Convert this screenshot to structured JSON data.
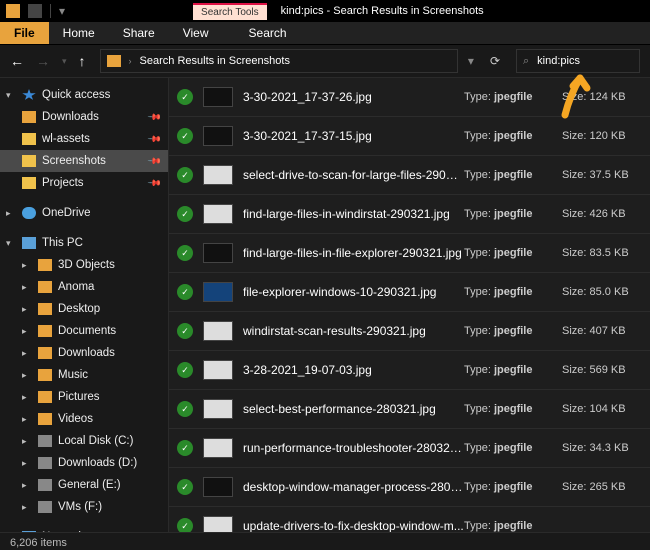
{
  "title": {
    "search_tools": "Search Tools",
    "window": "kind:pics - Search Results in Screenshots"
  },
  "menu": {
    "file": "File",
    "home": "Home",
    "share": "Share",
    "view": "View",
    "search": "Search"
  },
  "toolbar": {
    "path": "Search Results in Screenshots",
    "search_value": "kind:pics"
  },
  "tree": {
    "quick_access": "Quick access",
    "qa": [
      {
        "label": "Downloads"
      },
      {
        "label": "wl-assets"
      },
      {
        "label": "Screenshots"
      },
      {
        "label": "Projects"
      }
    ],
    "onedrive": "OneDrive",
    "this_pc": "This PC",
    "pc": [
      {
        "label": "3D Objects"
      },
      {
        "label": "Anoma"
      },
      {
        "label": "Desktop"
      },
      {
        "label": "Documents"
      },
      {
        "label": "Downloads"
      },
      {
        "label": "Music"
      },
      {
        "label": "Pictures"
      },
      {
        "label": "Videos"
      },
      {
        "label": "Local Disk (C:)"
      },
      {
        "label": "Downloads (D:)"
      },
      {
        "label": "General (E:)"
      },
      {
        "label": "VMs (F:)"
      }
    ],
    "network": "Network"
  },
  "type_prefix": "Type: ",
  "size_prefix": "Size: ",
  "files": [
    {
      "name": "3-30-2021_17-37-26.jpg",
      "type": "jpegfile",
      "size": "124 KB",
      "thumb": "dark"
    },
    {
      "name": "3-30-2021_17-37-15.jpg",
      "type": "jpegfile",
      "size": "120 KB",
      "thumb": "dark"
    },
    {
      "name": "select-drive-to-scan-for-large-files-29032...",
      "type": "jpegfile",
      "size": "37.5 KB",
      "thumb": "light"
    },
    {
      "name": "find-large-files-in-windirstat-290321.jpg",
      "type": "jpegfile",
      "size": "426 KB",
      "thumb": "light"
    },
    {
      "name": "find-large-files-in-file-explorer-290321.jpg",
      "type": "jpegfile",
      "size": "83.5 KB",
      "thumb": "dark"
    },
    {
      "name": "file-explorer-windows-10-290321.jpg",
      "type": "jpegfile",
      "size": "85.0 KB",
      "thumb": "blue"
    },
    {
      "name": "windirstat-scan-results-290321.jpg",
      "type": "jpegfile",
      "size": "407 KB",
      "thumb": "light"
    },
    {
      "name": "3-28-2021_19-07-03.jpg",
      "type": "jpegfile",
      "size": "569 KB",
      "thumb": "light"
    },
    {
      "name": "select-best-performance-280321.jpg",
      "type": "jpegfile",
      "size": "104 KB",
      "thumb": "light"
    },
    {
      "name": "run-performance-troubleshooter-280321.j...",
      "type": "jpegfile",
      "size": "34.3 KB",
      "thumb": "light"
    },
    {
      "name": "desktop-window-manager-process-28031...",
      "type": "jpegfile",
      "size": "265 KB",
      "thumb": "dark"
    },
    {
      "name": "update-drivers-to-fix-desktop-window-m...",
      "type": "jpegfile",
      "size": "",
      "thumb": "light"
    }
  ],
  "status": {
    "items": "6,206 items"
  }
}
